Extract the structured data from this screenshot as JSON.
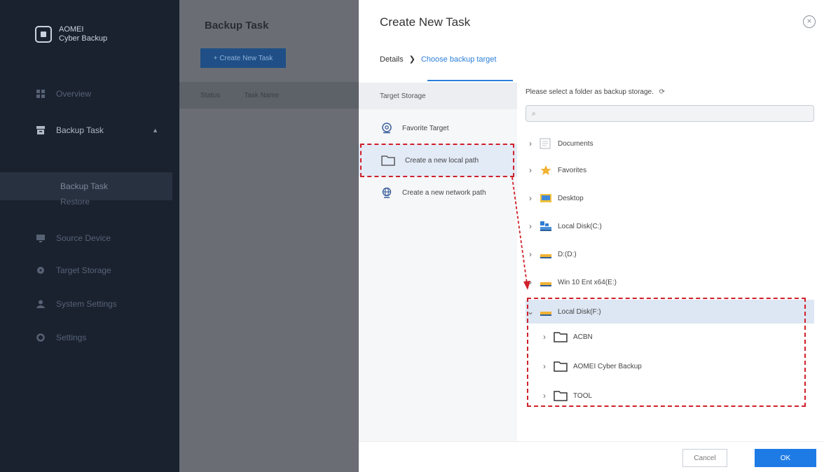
{
  "app": {
    "logo_line1": "AOMEI",
    "logo_line2": "Cyber Backup",
    "nav": [
      {
        "label": "Overview",
        "icon": "grid-icon"
      },
      {
        "label": "Backup Task",
        "icon": "archive-icon"
      },
      {
        "label": "Backup Task"
      },
      {
        "label": "Restore"
      },
      {
        "label": "Source Device",
        "icon": "monitor-icon"
      },
      {
        "label": "Target Storage",
        "icon": "disk-icon"
      },
      {
        "label": "System Settings",
        "icon": "person-icon"
      },
      {
        "label": "Settings",
        "icon": "gear-icon"
      }
    ]
  },
  "main": {
    "title": "Backup Task",
    "create_button": "+ Create New Task",
    "columns": [
      "Status",
      "Task Name"
    ]
  },
  "dialog": {
    "title": "Create New Task",
    "close": "×",
    "steps": {
      "details": "Details",
      "separator": "❯",
      "active": "Choose backup target"
    },
    "target_header": "Target Storage",
    "targets": [
      {
        "label": "Favorite Target",
        "icon": "location-pin-icon"
      },
      {
        "label": "Create a new local path",
        "icon": "folder-icon"
      },
      {
        "label": "Create a new network path",
        "icon": "network-globe-icon"
      }
    ],
    "folder_hint": "Please select a folder as backup storage.",
    "refresh": "⟳",
    "search_placeholder": "⌕",
    "tree": [
      {
        "label": "Documents",
        "icon": "document-folder-icon",
        "chevron": "›"
      },
      {
        "label": "Favorites",
        "icon": "star-icon",
        "chevron": "›"
      },
      {
        "label": "Desktop",
        "icon": "desktop-folder-icon",
        "chevron": "›"
      },
      {
        "label": "Local Disk(C:)",
        "icon": "system-drive-icon",
        "chevron": "›"
      },
      {
        "label": "D:(D:)",
        "icon": "drive-icon",
        "chevron": "›"
      },
      {
        "label": "Win 10 Ent x64(E:)",
        "icon": "drive-icon",
        "chevron": "›"
      },
      {
        "label": "Local Disk(F:)",
        "icon": "drive-icon",
        "chevron": "⌄"
      },
      {
        "label": "ACBN",
        "icon": "folder-icon",
        "chevron": "›"
      },
      {
        "label": "AOMEI Cyber Backup",
        "icon": "folder-icon",
        "chevron": "›"
      },
      {
        "label": "TOOL",
        "icon": "folder-icon",
        "chevron": "›"
      }
    ],
    "cancel": "Cancel",
    "ok": "OK"
  },
  "colors": {
    "accent": "#1e7be6",
    "highlight_red": "#d0202a",
    "sidebar_bg": "#1a2230",
    "overlay_bg": "#6a6e74"
  }
}
